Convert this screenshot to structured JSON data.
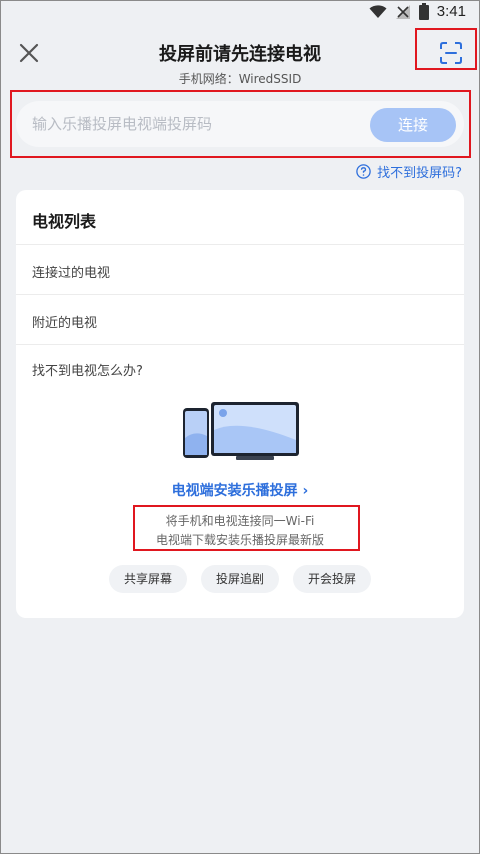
{
  "status_bar": {
    "time": "3:41",
    "icons": [
      "wifi-icon",
      "signal-off-icon",
      "battery-icon"
    ]
  },
  "header": {
    "title": "投屏前请先连接电视",
    "subtitle": "手机网络：WiredSSID",
    "close_icon": "close-icon",
    "scan_icon": "scan-icon"
  },
  "connect": {
    "placeholder": "输入乐播投屏电视端投屏码",
    "value": "",
    "button_label": "连接"
  },
  "help": {
    "label": "找不到投屏码?",
    "icon": "question-circle-icon"
  },
  "tv_list": {
    "title": "电视列表",
    "rows": [
      "连接过的电视",
      "附近的电视"
    ],
    "question": "找不到电视怎么办?",
    "install_link": "电视端安装乐播投屏",
    "tips": [
      "将手机和电视连接同一Wi-Fi",
      "电视端下载安装乐播投屏最新版"
    ],
    "chips": [
      "共享屏幕",
      "投屏追剧",
      "开会投屏"
    ]
  },
  "colors": {
    "accent": "#2e6fdc",
    "button_disabled": "#a7c4f6",
    "annotation_red": "#e0171f",
    "background": "#eef0f3"
  }
}
